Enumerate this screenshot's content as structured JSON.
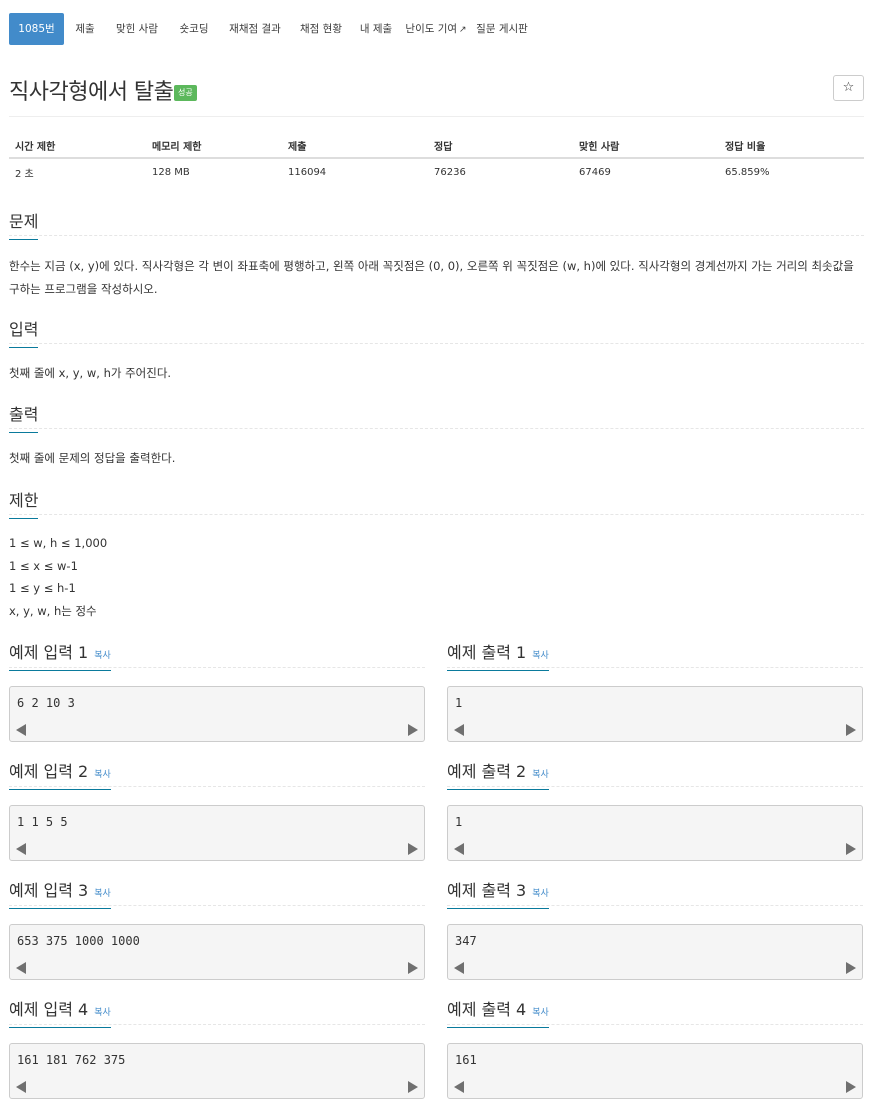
{
  "nav": {
    "tabs": [
      {
        "label": "1085번",
        "active": true
      },
      {
        "label": "제출"
      },
      {
        "label": "맞힌 사람"
      },
      {
        "label": "숏코딩"
      },
      {
        "label": "재채점 결과"
      },
      {
        "label": "채점 현황"
      },
      {
        "label": "내 제출"
      },
      {
        "label": "난이도 기여",
        "icon": "external-link-icon"
      },
      {
        "label": "질문 게시판"
      }
    ],
    "active_color": "#428bca"
  },
  "problem": {
    "title": "직사각형에서 탈출",
    "badge": "성공",
    "badge_color": "#5cb85c",
    "star": "☆"
  },
  "info": {
    "headers": [
      "시간 제한",
      "메모리 제한",
      "제출",
      "정답",
      "맞힌 사람",
      "정답 비율"
    ],
    "values": [
      "2 초",
      "128 MB",
      "116094",
      "76236",
      "67469",
      "65.859%"
    ]
  },
  "sections": {
    "problem": {
      "title": "문제",
      "text_1": "한수는 지금 (x, y)에 있다. 직사각형은 각 변이 좌표축에 평행하고, 왼쪽 아래 꼭짓점은 (0, 0), 오른쪽 위 꼭짓점은 (w, h)에 있다. 직사각형의 경계선까지 가는 거리의 최솟값을",
      "text_2": "구하는 프로그램을 작성하시오."
    },
    "input": {
      "title": "입력",
      "text": "첫째 줄에 x, y, w, h가 주어진다."
    },
    "output": {
      "title": "출력",
      "text": "첫째 줄에 문제의 정답을 출력한다."
    },
    "limits": {
      "title": "제한",
      "lines": [
        "1 ≤ w, h ≤ 1,000",
        "1 ≤ x ≤ w-1",
        "1 ≤ y ≤ h-1",
        "x, y, w, h는 정수"
      ]
    }
  },
  "samples": {
    "copy_label": "복사",
    "items": [
      {
        "input_title": "예제 입력 1",
        "input": "6 2 10 3",
        "output_title": "예제 출력 1",
        "output": "1"
      },
      {
        "input_title": "예제 입력 2",
        "input": "1 1 5 5",
        "output_title": "예제 출력 2",
        "output": "1"
      },
      {
        "input_title": "예제 입력 3",
        "input": "653 375 1000 1000",
        "output_title": "예제 출력 3",
        "output": "347"
      },
      {
        "input_title": "예제 입력 4",
        "input": "161 181 762 375",
        "output_title": "예제 출력 4",
        "output": "161"
      }
    ]
  }
}
